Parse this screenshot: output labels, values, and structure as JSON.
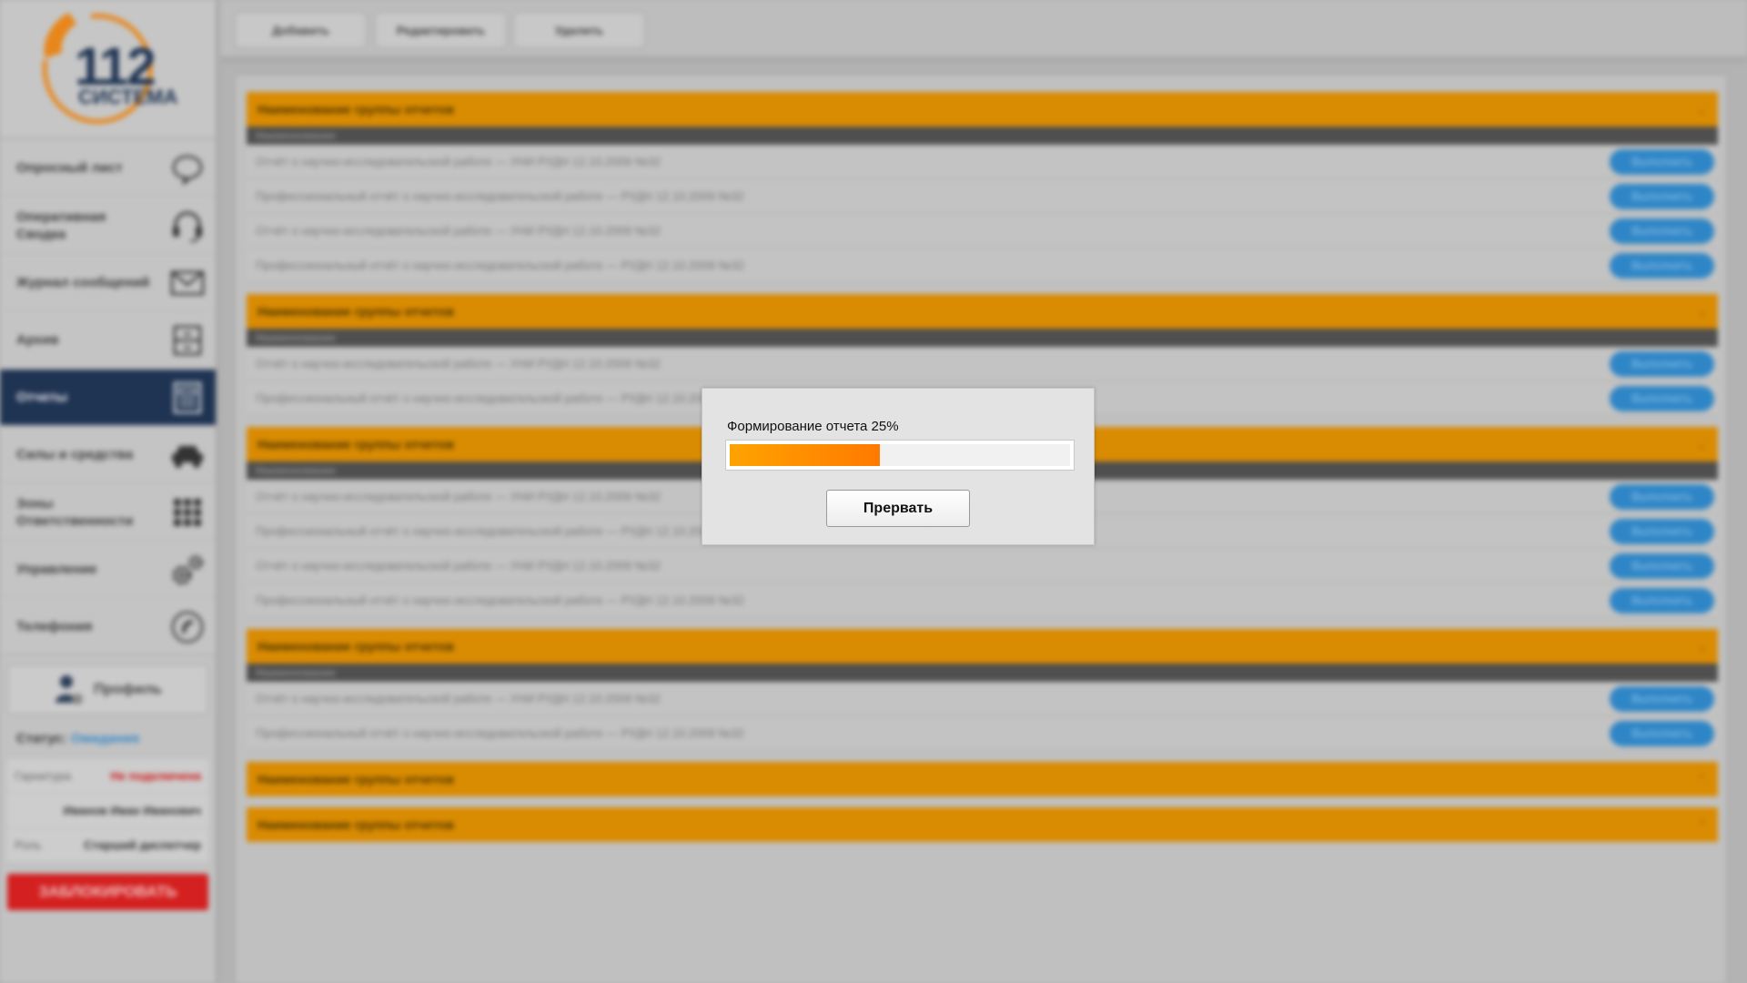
{
  "sidebar": {
    "logo": {
      "number": "112",
      "word": "СИСТЕМА"
    },
    "items": [
      {
        "label": "Опросный лист",
        "icon": "chat-bubble-icon"
      },
      {
        "label": "Оперативная Сводка",
        "icon": "headset-icon"
      },
      {
        "label": "Журнал сообщений",
        "icon": "envelope-icon"
      },
      {
        "label": "Архив",
        "icon": "archive-cabinet-icon"
      },
      {
        "label": "Отчеты",
        "icon": "report-document-icon",
        "active": true
      },
      {
        "label": "Силы и средства",
        "icon": "car-icon"
      },
      {
        "label": "Зоны Ответственности",
        "icon": "grid-icon"
      },
      {
        "label": "Управление",
        "icon": "gears-icon"
      },
      {
        "label": "Телефония",
        "icon": "phone-icon"
      }
    ],
    "profile_label": "Профиль",
    "status_label": "Статус:",
    "status_value": "Ожидание",
    "headset_key": "Гарнитура",
    "headset_value": "Не подключена",
    "user_name": "Иванов Иван Иванович",
    "role_key": "Роль",
    "role_value": "Старший диспетчер",
    "lock_label": "ЗАБЛОКИРОВАТЬ"
  },
  "toolbar": {
    "add_label": "Добавить",
    "edit_label": "Редактировать",
    "delete_label": "Удалить"
  },
  "groups": [
    {
      "title": "Наименование группы отчетов",
      "column": "Наименование",
      "rows": [
        "Отчёт о научно-исследовательской работе — УНИ РУДН 12.10.2009 №32",
        "Профессиональный отчёт о научно-исследовательской работе — РУДН 12.10.2009 №32",
        "Отчёт о научно-исследовательской работе — УНИ РУДН 12.10.2009 №32",
        "Профессиональный отчёт о научно-исследовательской работе — РУДН 12.10.2009 №32"
      ]
    },
    {
      "title": "Наименование группы отчетов",
      "column": "Наименование",
      "rows": [
        "Отчёт о научно-исследовательской работе — УНИ РУДН 12.10.2009 №32",
        "Профессиональный отчёт о научно-исследовательской работе — РУДН 12.10.2009 №32"
      ]
    },
    {
      "title": "Наименование группы отчетов",
      "column": "Наименование",
      "rows": [
        "Отчёт о научно-исследовательской работе — УНИ РУДН 12.10.2009 №32",
        "Профессиональный отчёт о научно-исследовательской работе — РУДН 12.10.2009 №32",
        "Отчёт о научно-исследовательской работе — УНИ РУДН 12.10.2009 №32",
        "Профессиональный отчёт о научно-исследовательской работе — РУДН 12.10.2009 №32"
      ]
    },
    {
      "title": "Наименование группы отчетов",
      "column": "Наименование",
      "rows": [
        "Отчёт о научно-исследовательской работе — УНИ РУДН 12.10.2009 №32",
        "Профессиональный отчёт о научно-исследовательской работе — РУДН 12.10.2009 №32"
      ]
    },
    {
      "title": "Наименование группы отчетов",
      "collapsed": true,
      "rows": []
    },
    {
      "title": "Наименование группы отчетов",
      "collapsed": true,
      "rows": []
    }
  ],
  "row_button_label": "Выполнить",
  "modal": {
    "title": "Формирование отчета 25%",
    "progress_percent": 25,
    "abort_label": "Прервать"
  },
  "colors": {
    "group_header": "#d98b02",
    "active_nav": "#1f3353",
    "row_button": "#2f86c6",
    "lock_button": "#d42020",
    "progress": "#ff8c00"
  }
}
